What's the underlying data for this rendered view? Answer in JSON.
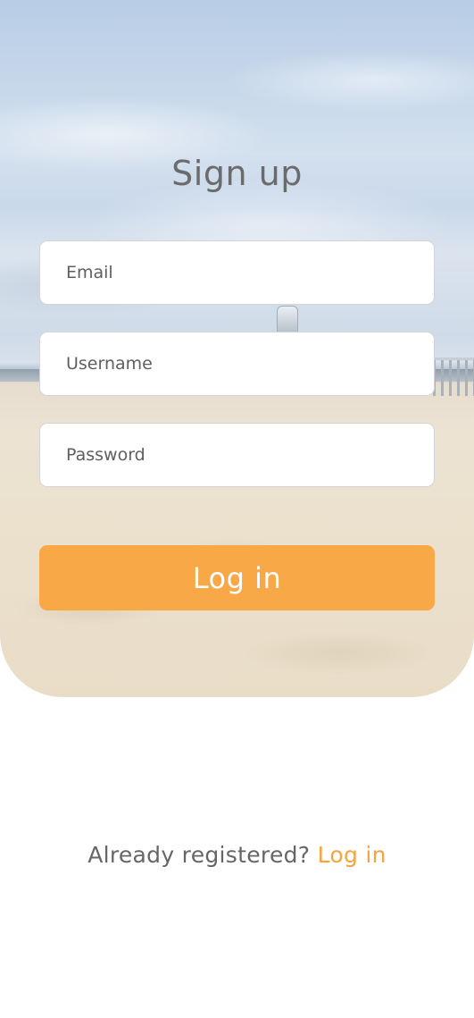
{
  "colors": {
    "accent": "#f9a847",
    "link": "#f7a33e",
    "title_text": "#6b6b6b",
    "field_border": "#d4d4dc"
  },
  "hero": {
    "background_image": "beach-scene"
  },
  "form": {
    "title": "Sign up",
    "email": {
      "placeholder": "Email",
      "value": ""
    },
    "username": {
      "placeholder": "Username",
      "value": ""
    },
    "password": {
      "placeholder": "Password",
      "value": ""
    },
    "submit_label": "Log in"
  },
  "footer": {
    "prompt": "Already registered?",
    "link_label": "Log in"
  }
}
